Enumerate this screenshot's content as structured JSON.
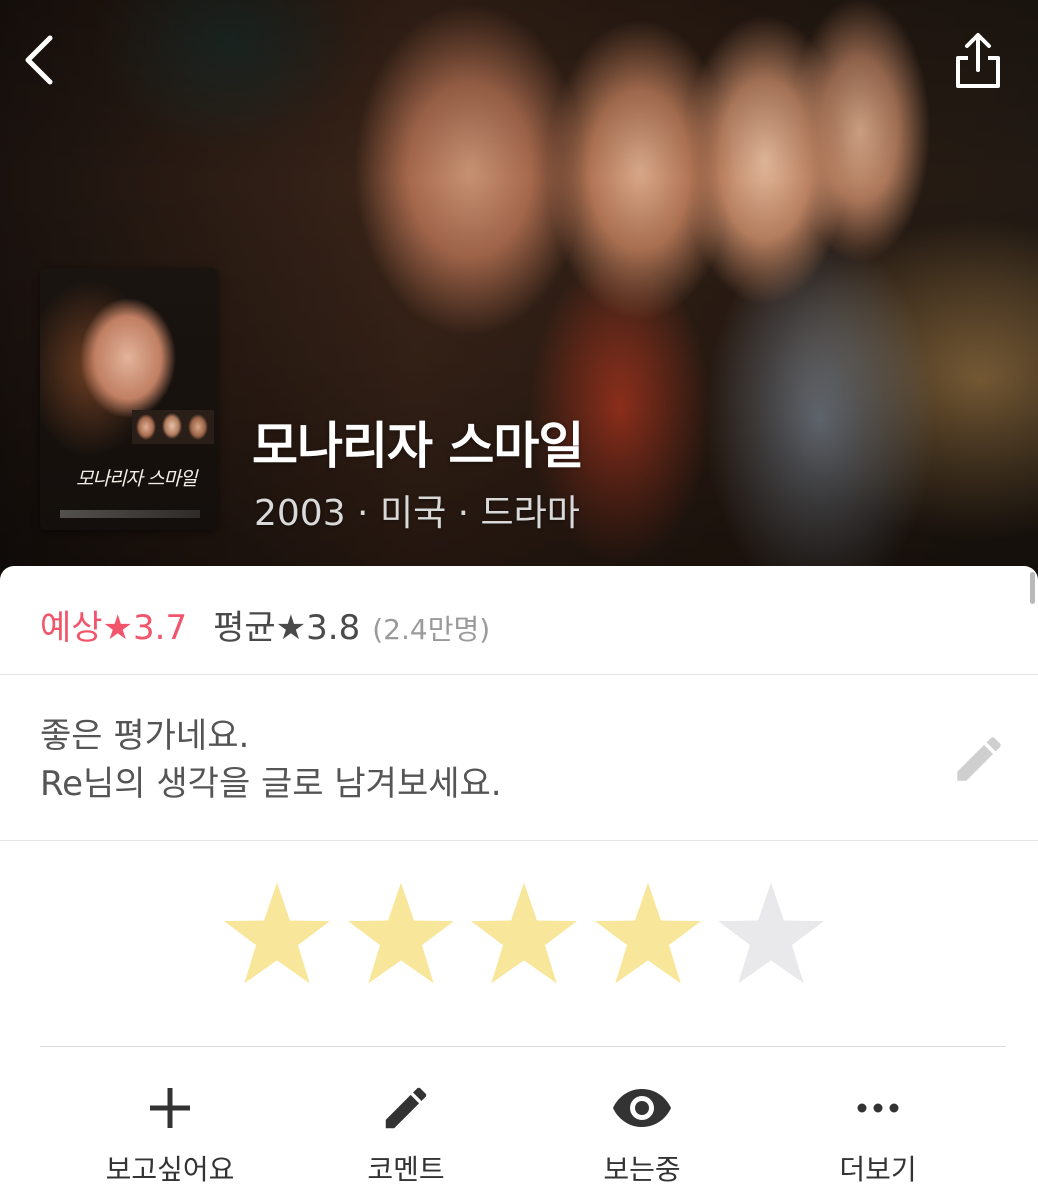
{
  "header": {
    "back_icon": "chevron-left-icon",
    "share_icon": "share-icon"
  },
  "movie": {
    "title": "모나리자 스마일",
    "meta": "2003 · 미국 · 드라마",
    "poster_title": "모나리자 스마일"
  },
  "rating": {
    "predicted_label": "예상★3.7",
    "average_label": "평균★3.8",
    "count_label": "(2.4만명)",
    "predicted_color": "#f2546b"
  },
  "comment_prompt": {
    "line1": "좋은 평가네요.",
    "line2": "Re님의 생각을 글로 남겨보세요.",
    "edit_icon": "pencil-icon"
  },
  "user_rating": {
    "stars_filled": 4,
    "stars_total": 5,
    "filled_color": "#f8e69a",
    "empty_color": "#e9e9ec"
  },
  "actions": [
    {
      "label": "보고싶어요",
      "icon": "plus-icon"
    },
    {
      "label": "코멘트",
      "icon": "pencil-icon"
    },
    {
      "label": "보는중",
      "icon": "eye-icon"
    },
    {
      "label": "더보기",
      "icon": "more-icon"
    }
  ]
}
